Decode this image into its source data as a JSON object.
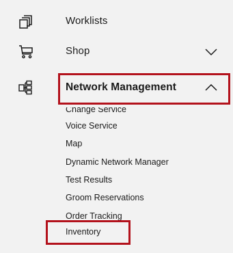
{
  "colors": {
    "background": "#f2f2f2",
    "text": "#1a1a1a",
    "highlight": "#b3121c"
  },
  "nav": {
    "items": [
      {
        "icon": "worklists-icon",
        "label": "Worklists"
      },
      {
        "icon": "cart-icon",
        "label": "Shop",
        "chevron": "chevron-down-icon"
      },
      {
        "icon": "network-management-icon",
        "label": "Network Management",
        "chevron": "chevron-up-icon",
        "expanded": true
      }
    ],
    "network_sub": [
      "Change Service",
      "Voice Service",
      "Map",
      "Dynamic Network Manager",
      "Test Results",
      "Groom Reservations",
      "Order Tracking",
      "Inventory"
    ]
  }
}
